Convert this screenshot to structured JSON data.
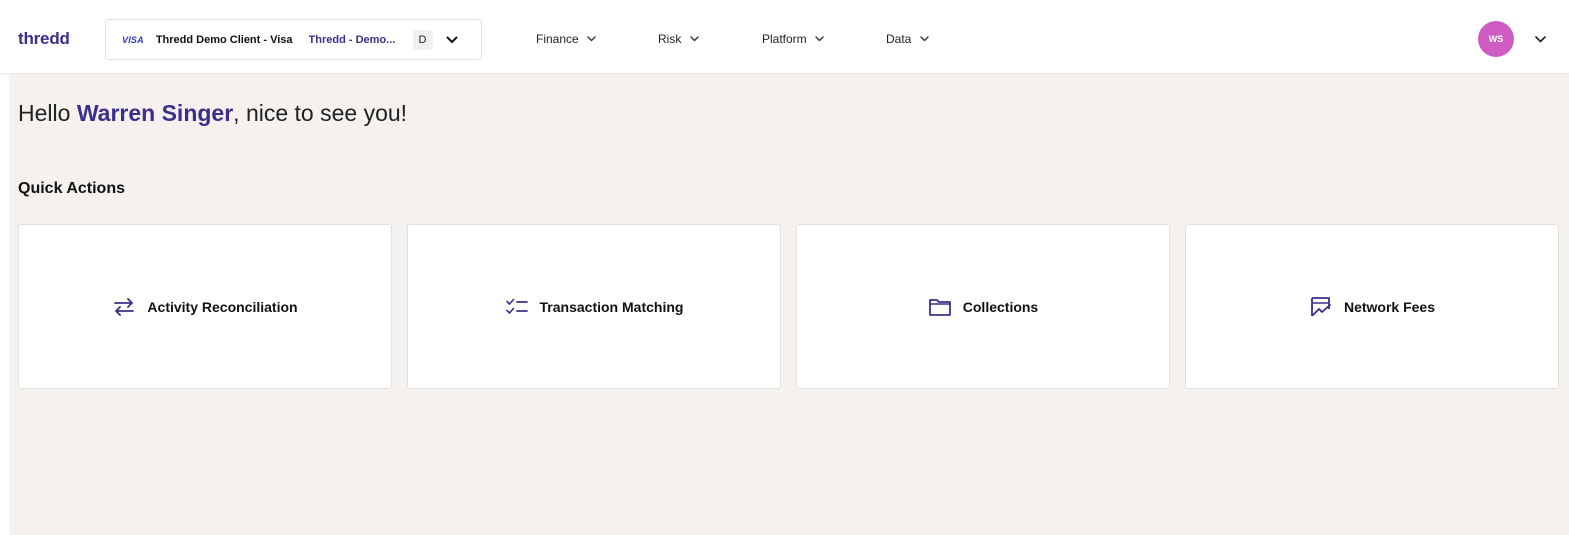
{
  "header": {
    "logo_text": "thredd",
    "client_selector": {
      "network": "VISA",
      "client_name": "Thredd Demo Client - Visa",
      "program_name": "Thredd - Demo...",
      "environment": "D",
      "chevron_icon": "chevron-down-icon"
    },
    "nav": [
      {
        "label": "Finance",
        "icon": "chevron-down-icon"
      },
      {
        "label": "Risk",
        "icon": "chevron-down-icon"
      },
      {
        "label": "Platform",
        "icon": "chevron-down-icon"
      },
      {
        "label": "Data",
        "icon": "chevron-down-icon"
      }
    ],
    "user": {
      "initials": "WS",
      "avatar_color": "#cf5cc3"
    }
  },
  "main": {
    "greeting": {
      "prefix": "Hello ",
      "name": "Warren Singer",
      "suffix": ", nice to see you!"
    },
    "quick_actions": {
      "title": "Quick Actions",
      "items": [
        {
          "label": "Activity Reconciliation",
          "icon": "swap-arrows-icon"
        },
        {
          "label": "Transaction Matching",
          "icon": "checklist-icon"
        },
        {
          "label": "Collections",
          "icon": "folder-icon"
        },
        {
          "label": "Network Fees",
          "icon": "chart-document-icon"
        }
      ]
    }
  },
  "colors": {
    "brand": "#3d2e8c",
    "background": "#f4f1ee",
    "avatar": "#cf5cc3"
  }
}
